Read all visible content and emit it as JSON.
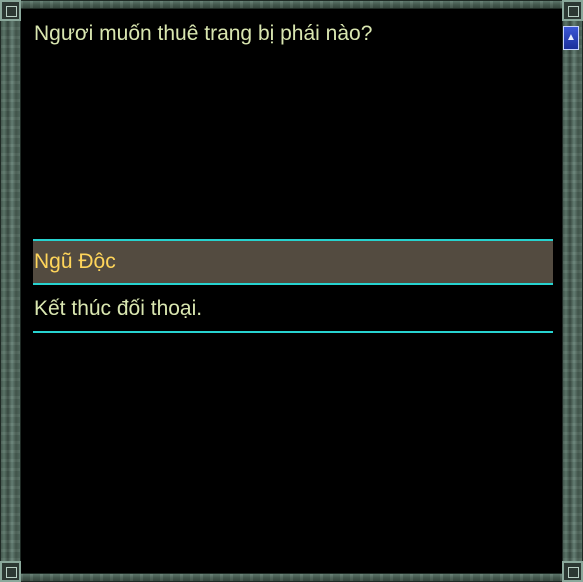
{
  "dialog": {
    "question": "Ngươi muốn thuê trang bị phái nào?",
    "options": [
      {
        "label": "Ngũ Độc",
        "selected": true
      },
      {
        "label": "Kết thúc đối thoại.",
        "selected": false
      }
    ]
  },
  "scrollbar": {
    "up_icon": "chevron-up-icon"
  },
  "colors": {
    "background": "#000000",
    "text": "#d9e6b0",
    "selected_text": "#ffd55a",
    "selected_bg": "#534b40",
    "divider": "#27d3d0",
    "frame": "#587166",
    "scroll_button": "#2b45c4"
  }
}
